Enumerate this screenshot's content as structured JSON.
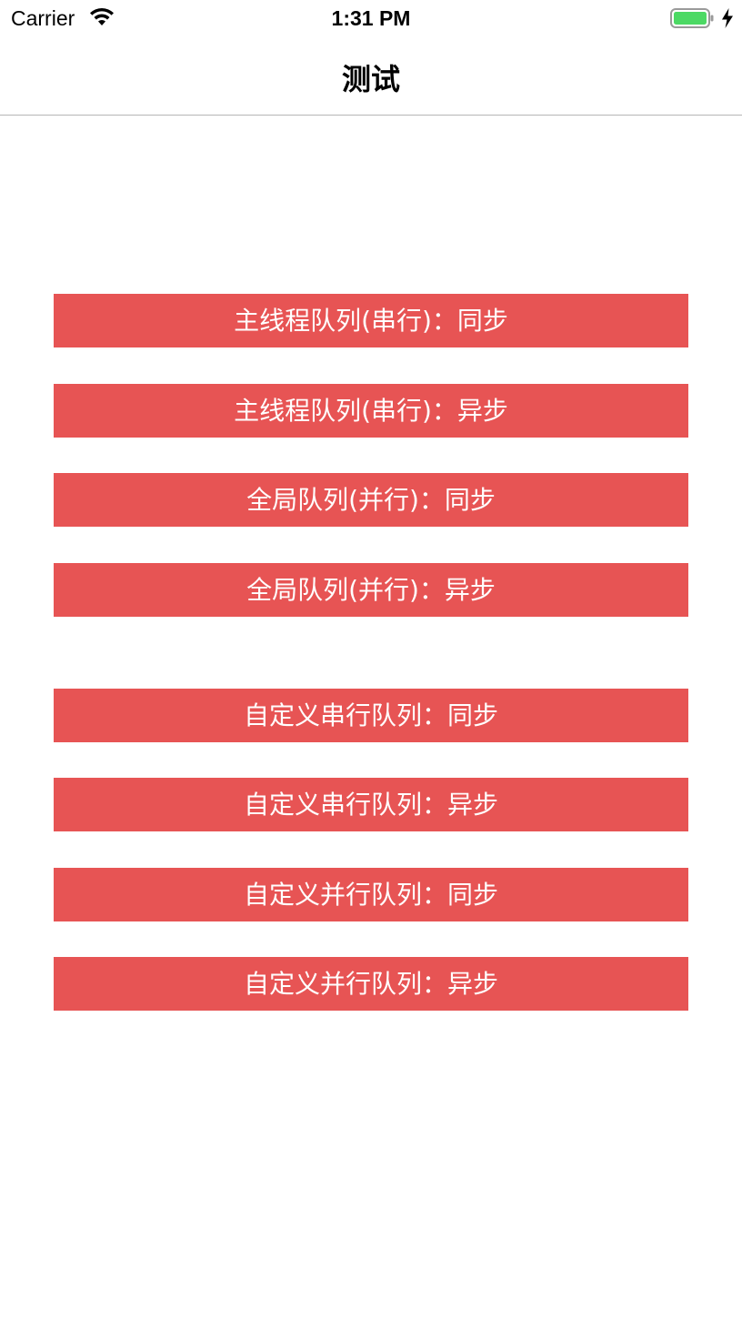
{
  "status_bar": {
    "carrier": "Carrier",
    "time": "1:31 PM",
    "wifi_icon": "wifi-icon",
    "battery_icon": "battery-icon",
    "charging_icon": "charging-bolt-icon",
    "battery_color": "#4cd964",
    "battery_level": 1.0
  },
  "nav": {
    "title": "测试"
  },
  "accent_color": "#e75454",
  "buttons": [
    "主线程队列(串行)：同步",
    "主线程队列(串行)：异步",
    "全局队列(并行)：同步",
    "全局队列(并行)：异步",
    "自定义串行队列：同步",
    "自定义串行队列：异步",
    "自定义并行队列：同步",
    "自定义并行队列：异步"
  ]
}
